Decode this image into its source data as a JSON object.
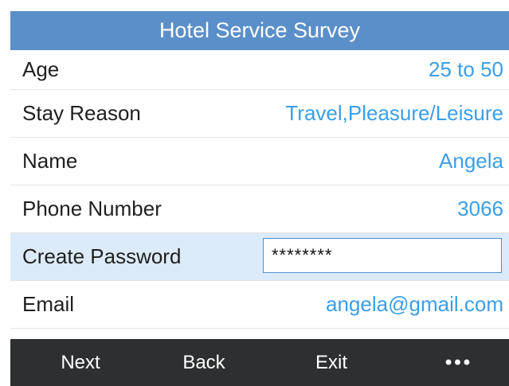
{
  "title": "Hotel Service Survey",
  "fields": [
    {
      "label": "Age",
      "value": "25 to 50"
    },
    {
      "label": "Stay Reason",
      "value": "Travel,Pleasure/Leisure"
    },
    {
      "label": "Name",
      "value": "Angela"
    },
    {
      "label": "Phone Number",
      "value": "3066"
    },
    {
      "label": "Create Password",
      "value": "********"
    },
    {
      "label": "Email",
      "value": "angela@gmail.com"
    }
  ],
  "softkeys": {
    "next": "Next",
    "back": "Back",
    "exit": "Exit",
    "more": "•••"
  },
  "colors": {
    "title_bar": "#5b8fc9",
    "value_text": "#3b9ee8",
    "selected_row": "#dcebf9",
    "softkey_bar": "#2e2f31"
  }
}
